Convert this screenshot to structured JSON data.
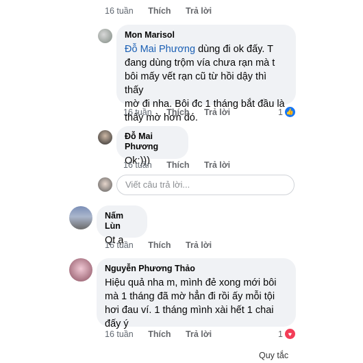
{
  "top_meta": {
    "time": "16 tuần",
    "like": "Thích",
    "reply": "Trả lời"
  },
  "comments": [
    {
      "author": "Mon Marisol",
      "mention": "Đỗ Mai Phương",
      "lines": [
        " dùng đi ok đấy. T",
        "đang dùng trộm vía chưa rạn mà t",
        "bôi mấy vết rạn cũ từ hồi dậy thì thấy",
        "mờ đi nha. Bôi đc 1 tháng bắt đầu là",
        "thấy mờ hơn đó."
      ],
      "time": "16 tuần",
      "like": "Thích",
      "reply": "Trả lời",
      "reactions": "1",
      "reaction_icon": "like-icon",
      "reaction_color": "#1877f2"
    },
    {
      "author": "Đỗ Mai Phương",
      "text": "Ok:)))",
      "time": "16 tuần",
      "like": "Thích",
      "reply": "Trả lời"
    },
    {
      "author": "Nấm Lùn",
      "text": "Qt ạ",
      "time": "16 tuần",
      "like": "Thích",
      "reply": "Trả lời"
    },
    {
      "author": "Nguyễn Phương Thảo",
      "lines": [
        "Hiệu quả nha m, mình đẻ xong mới bôi",
        "mà 1 tháng đã mờ hẳn đi rồi ấy mỗi tội",
        "hơi đau ví. 1 tháng mình xài hết 1 chai",
        "đấy ý"
      ],
      "time": "16 tuần",
      "like": "Thích",
      "reply": "Trả lời",
      "reactions": "1",
      "reaction_icon": "heart-icon",
      "reaction_color": "#f33e58"
    }
  ],
  "reply_box": {
    "placeholder": "Viết câu trả lời..."
  },
  "footer": {
    "label": "Quy tắc"
  }
}
